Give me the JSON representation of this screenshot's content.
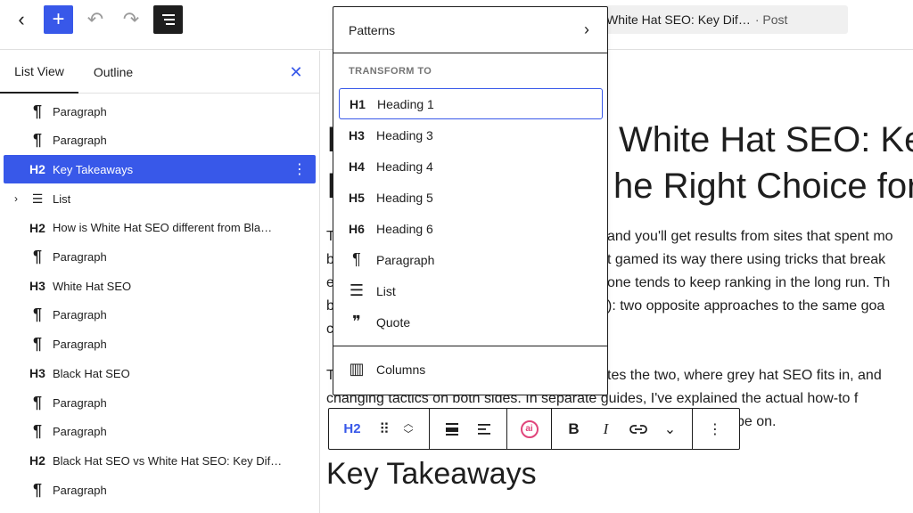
{
  "topbar": {
    "back_icon": "‹",
    "add_icon": "+",
    "undo_icon": "↶",
    "redo_icon": "↷",
    "doc_title": "White Hat SEO: Key Dif…",
    "doc_type": "· Post"
  },
  "sidebar": {
    "tabs": [
      "List View",
      "Outline"
    ],
    "close_icon": "✕",
    "rows": [
      {
        "icon": "¶",
        "label": "Paragraph"
      },
      {
        "icon": "¶",
        "label": "Paragraph"
      },
      {
        "icon": "H2",
        "label": "Key Takeaways",
        "selected": true
      },
      {
        "icon": "☰",
        "label": "List",
        "caret": "›"
      },
      {
        "icon": "H2",
        "label": "How is White Hat SEO different from Bla…"
      },
      {
        "icon": "¶",
        "label": "Paragraph"
      },
      {
        "icon": "H3",
        "label": "White Hat SEO"
      },
      {
        "icon": "¶",
        "label": "Paragraph"
      },
      {
        "icon": "¶",
        "label": "Paragraph"
      },
      {
        "icon": "H3",
        "label": "Black Hat SEO"
      },
      {
        "icon": "¶",
        "label": "Paragraph"
      },
      {
        "icon": "¶",
        "label": "Paragraph"
      },
      {
        "icon": "H2",
        "label": "Black Hat SEO vs White Hat SEO: Key Dif…"
      },
      {
        "icon": "¶",
        "label": "Paragraph"
      }
    ],
    "more_icon": "⋮"
  },
  "canvas": {
    "title_line1": "White Hat SEO: Ke",
    "title_line2": "he Right Choice for",
    "para_lines": [
      "and you'll get results from sites that spent mo",
      "t gamed its way there using tricks that break",
      "one tends to keep ranking in the long run. Th",
      "): two opposite approaches to the same goa"
    ],
    "para_left": [
      "T",
      "b",
      "e",
      "b",
      "c"
    ],
    "para2_line1_right": "tes the two, where grey hat SEO fits in, and",
    "para2_line1_left": "T",
    "para2_line2": "changing tactics on both sides. In separate guides, I've explained the actual how-to f",
    "para2_line3_right": "be on.",
    "heading_kt": "Key Takeaways"
  },
  "toolbar": {
    "h2": "H2",
    "drag_icon": "⠿",
    "up_icon": "︿",
    "down_icon": "﹀",
    "align_icon": "≡",
    "align2_icon": "☰",
    "ai_icon": "ai",
    "bold": "B",
    "italic": "I",
    "link_icon": "🔗",
    "more_down": "⌄",
    "options": "⋮"
  },
  "popover": {
    "patterns": "Patterns",
    "patterns_chev": "›",
    "section": "TRANSFORM TO",
    "items": [
      {
        "icon": "H1",
        "label": "Heading 1",
        "active": true
      },
      {
        "icon": "H3",
        "label": "Heading 3"
      },
      {
        "icon": "H4",
        "label": "Heading 4"
      },
      {
        "icon": "H5",
        "label": "Heading 5"
      },
      {
        "icon": "H6",
        "label": "Heading 6"
      },
      {
        "icon": "¶",
        "label": "Paragraph"
      },
      {
        "icon": "☰",
        "label": "List"
      },
      {
        "icon": "❞",
        "label": "Quote"
      }
    ],
    "columns_icon": "▥",
    "columns": "Columns"
  }
}
